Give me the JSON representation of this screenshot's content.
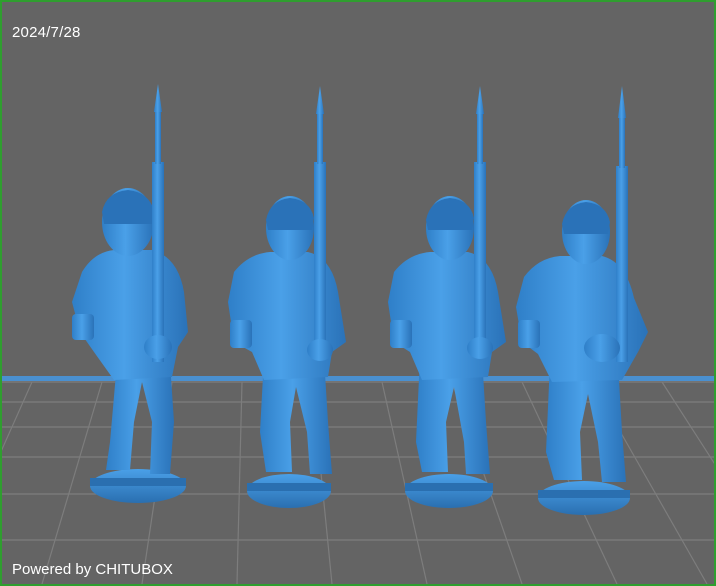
{
  "viewport": {
    "date_stamp": "2024/7/28",
    "powered_by": "Powered by CHITUBOX",
    "model_color": "#3a8fd8",
    "background_color": "#646464",
    "grid_color": "#7d7d7d",
    "frame_color": "#2f9e2f"
  },
  "scene": {
    "model_name_icons": [
      "soldier-figure-1",
      "soldier-figure-2",
      "soldier-figure-3",
      "soldier-figure-4"
    ]
  }
}
